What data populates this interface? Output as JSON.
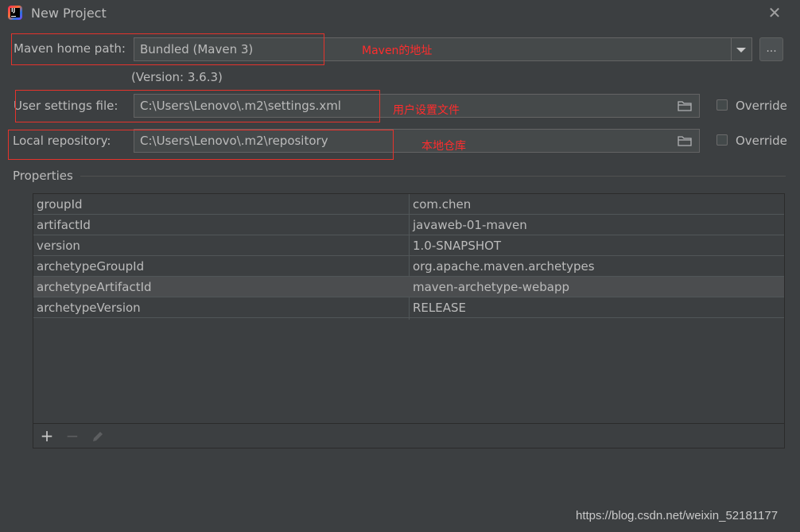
{
  "window": {
    "title": "New Project",
    "app_icon": "intellij-idea-icon",
    "close_icon": "close-icon"
  },
  "maven": {
    "home_label": "Maven home path:",
    "home_value": "Bundled (Maven 3)",
    "browse_label": "...",
    "version_text": "(Version: 3.6.3)",
    "settings_label": "User settings file:",
    "settings_value": "C:\\Users\\Lenovo\\.m2\\settings.xml",
    "settings_override": "Override",
    "repo_label": "Local repository:",
    "repo_value": "C:\\Users\\Lenovo\\.m2\\repository",
    "repo_override": "Override"
  },
  "annotations": {
    "maven_home": "Maven的地址",
    "settings": "用户设置文件",
    "repository": "本地仓库",
    "color": "#e5332c"
  },
  "properties": {
    "title": "Properties",
    "rows": [
      {
        "key": "groupId",
        "value": "com.chen"
      },
      {
        "key": "artifactId",
        "value": "javaweb-01-maven"
      },
      {
        "key": "version",
        "value": "1.0-SNAPSHOT"
      },
      {
        "key": "archetypeGroupId",
        "value": "org.apache.maven.archetypes"
      },
      {
        "key": "archetypeArtifactId",
        "value": "maven-archetype-webapp"
      },
      {
        "key": "archetypeVersion",
        "value": "RELEASE"
      }
    ],
    "toolbar": {
      "add": "+",
      "remove": "−",
      "edit": "edit-icon"
    }
  },
  "watermark": "https://blog.csdn.net/weixin_52181177",
  "colors": {
    "background": "#3c3f41",
    "field": "#45494a",
    "text": "#bbbbbb",
    "selected_row": "#4b4d4f"
  }
}
